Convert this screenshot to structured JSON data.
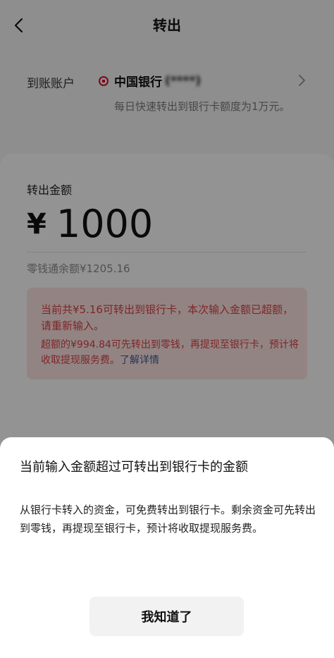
{
  "header": {
    "title": "转出"
  },
  "account": {
    "label": "到账账户",
    "bank_name": "中国银行",
    "bank_mask": "(****)",
    "limit_note": "每日快速转出到银行卡额度为1万元。"
  },
  "amount": {
    "label": "转出金额",
    "currency": "¥",
    "value": "1000",
    "balance": "零钱通余额¥1205.16"
  },
  "warning": {
    "line1": "当前共¥5.16可转出到银行卡，本次输入金额已超额，请重新输入。",
    "line2": "超额的¥994.84可先转出到零钱，再提现至银行卡，预计将收取提现服务费。",
    "link": "了解详情"
  },
  "dialog": {
    "title": "当前输入金额超过可转出到银行卡的金额",
    "body": "从银行卡转入的资金，可免费转出到银行卡。剩余资金可先转出到零钱，再提现至银行卡，预计将收取提现服务费。",
    "button": "我知道了"
  },
  "colors": {
    "bank_red": "#c8102e",
    "warning_text": "#d04040",
    "warning_bg": "#f6dcdc",
    "link": "#3b5a8c"
  }
}
